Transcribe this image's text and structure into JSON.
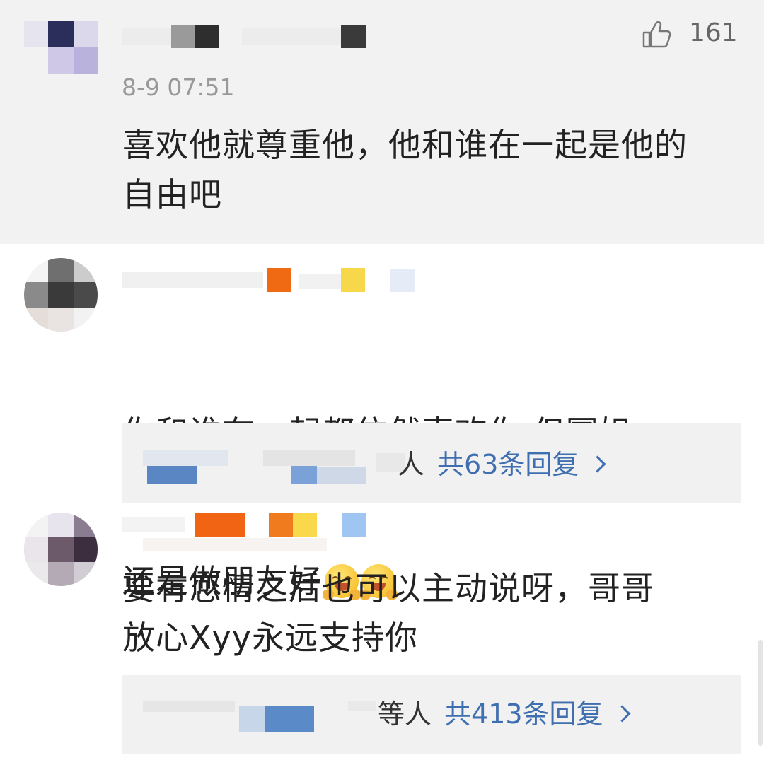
{
  "comments": [
    {
      "timestamp": "8-9 07:51",
      "likes": "161",
      "text": "喜欢他就尊重他，他和谁在一起是他的\n自由吧"
    },
    {
      "text_line1": "你和谁在一起都依然喜欢你 但幂姐",
      "text_line2": "还是做朋友好",
      "emojis": [
        "laughing-emoji",
        "laughing-emoji"
      ],
      "replies": {
        "who": "人",
        "count": "共63条回复"
      }
    },
    {
      "text": "要有恋情之后也可以主动说呀，哥哥\n放心Xyy永远支持你",
      "replies": {
        "who": "等人",
        "count": "共413条回复"
      }
    }
  ],
  "icons": {
    "like": "thumbs-up-icon",
    "chevron": "chevron-right-icon"
  },
  "colors": {
    "reply_link": "#3f6fb0",
    "timestamp": "#999999",
    "highlight_bg": "#f2f2f2"
  }
}
